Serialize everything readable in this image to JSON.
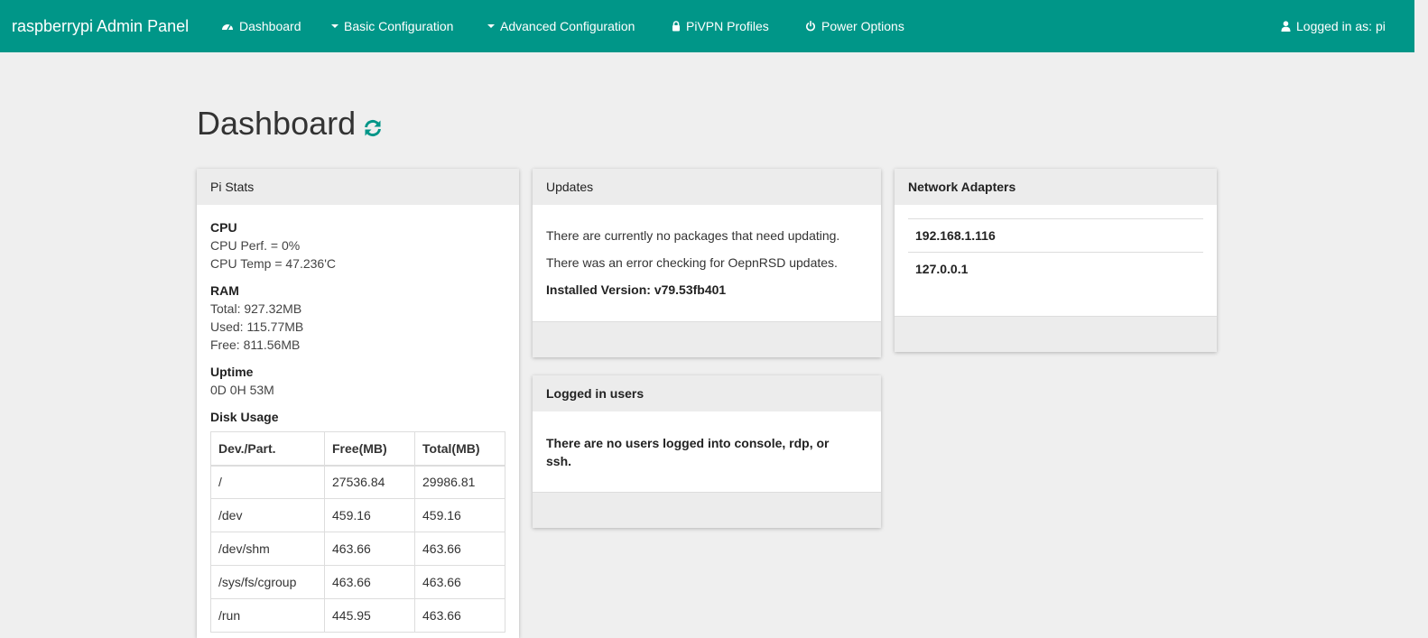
{
  "navbar": {
    "brand": "raspberrypi Admin Panel",
    "background": "#009688",
    "items": [
      {
        "label": "Dashboard",
        "icon": "dashboard-icon"
      },
      {
        "label": "Basic Configuration",
        "icon": "caret-down-icon"
      },
      {
        "label": "Advanced Configuration",
        "icon": "caret-down-icon"
      },
      {
        "label": "PiVPN Profiles",
        "icon": "lock-icon"
      },
      {
        "label": "Power Options",
        "icon": "power-icon"
      }
    ],
    "user": {
      "label": "Logged in as: pi",
      "icon": "user-icon"
    }
  },
  "page": {
    "title": "Dashboard",
    "refresh_icon": "refresh-icon",
    "accent": "#009688"
  },
  "pi_stats": {
    "heading": "Pi Stats",
    "cpu": {
      "label": "CPU",
      "perf": "CPU Perf. = 0%",
      "temp": "CPU Temp = 47.236'C"
    },
    "ram": {
      "label": "RAM",
      "total": "Total: 927.32MB",
      "used": "Used: 115.77MB",
      "free": "Free: 811.56MB"
    },
    "uptime": {
      "label": "Uptime",
      "value": "0D 0H 53M"
    },
    "disk": {
      "label": "Disk Usage",
      "columns": [
        "Dev./Part.",
        "Free(MB)",
        "Total(MB)"
      ],
      "rows": [
        [
          "/",
          "27536.84",
          "29986.81"
        ],
        [
          "/dev",
          "459.16",
          "459.16"
        ],
        [
          "/dev/shm",
          "463.66",
          "463.66"
        ],
        [
          "/sys/fs/cgroup",
          "463.66",
          "463.66"
        ],
        [
          "/run",
          "445.95",
          "463.66"
        ]
      ]
    }
  },
  "updates": {
    "heading": "Updates",
    "line1": "There are currently no packages that need updating.",
    "line2": "There was an error checking for OepnRSD updates.",
    "installed": "Installed Version: v79.53fb401"
  },
  "logged_users": {
    "heading": "Logged in users",
    "message": "There are no users logged into console, rdp, or ssh."
  },
  "network": {
    "heading": "Network Adapters",
    "adapters": [
      "192.168.1.116",
      "127.0.0.1"
    ]
  }
}
